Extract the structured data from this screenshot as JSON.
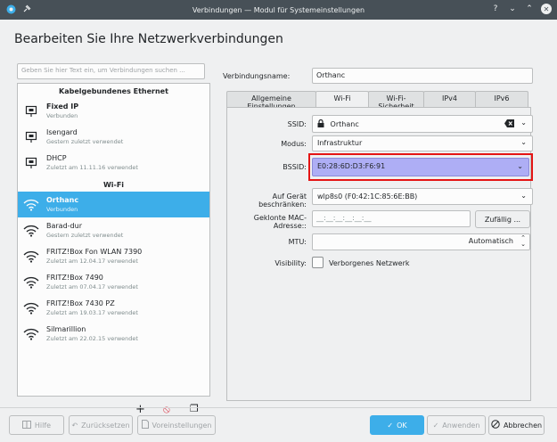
{
  "window": {
    "title": "Verbindungen — Modul für Systemeinstellungen",
    "help_glyph": "?",
    "min_glyph": "⌄",
    "max_glyph": "⌃",
    "close_glyph": "✕"
  },
  "heading": "Bearbeiten Sie Ihre Netzwerkverbindungen",
  "search": {
    "placeholder": "Geben Sie hier Text ein, um Verbindungen suchen ..."
  },
  "sections": {
    "wired": {
      "title": "Kabelgebundenes Ethernet",
      "items": [
        {
          "name": "Fixed IP",
          "sub": "Verbunden",
          "icon": "ethernet-icon",
          "bold": true
        },
        {
          "name": "Isengard",
          "sub": "Gestern zuletzt verwendet",
          "icon": "ethernet-icon"
        },
        {
          "name": "DHCP",
          "sub": "Zuletzt am 11.11.16 verwendet",
          "icon": "ethernet-icon"
        }
      ]
    },
    "wifi": {
      "title": "Wi-Fi",
      "items": [
        {
          "name": "Orthanc",
          "sub": "Verbunden",
          "icon": "wifi-icon",
          "bold": true,
          "selected": true
        },
        {
          "name": "Barad-dur",
          "sub": "Gestern zuletzt verwendet",
          "icon": "wifi-icon"
        },
        {
          "name": "FRITZ!Box Fon WLAN 7390",
          "sub": "Zuletzt am 12.04.17 verwendet",
          "icon": "wifi-icon"
        },
        {
          "name": "FRITZ!Box 7490",
          "sub": "Zuletzt am 07.04.17 verwendet",
          "icon": "wifi-icon"
        },
        {
          "name": "FRITZ!Box 7430 PZ",
          "sub": "Zuletzt am 19.03.17 verwendet",
          "icon": "wifi-icon"
        },
        {
          "name": "Silmarillion",
          "sub": "Zuletzt am 22.02.15 verwendet",
          "icon": "wifi-icon"
        }
      ]
    }
  },
  "list_tools": {
    "add": "+",
    "remove": "⦸",
    "export": "❐"
  },
  "connection": {
    "label": "Verbindungsname:",
    "value": "Orthanc"
  },
  "tabs": [
    "Allgemeine Einstellungen",
    "Wi-Fi",
    "Wi-Fi-Sicherheit",
    "IPv4",
    "IPv6"
  ],
  "active_tab": 1,
  "wifi": {
    "ssid_label": "SSID:",
    "ssid_value": "Orthanc",
    "mode_label": "Modus:",
    "mode_value": "Infrastruktur",
    "bssid_label": "BSSID:",
    "bssid_value": "E0:28:6D:D3:F6:91",
    "device_label": "Auf Gerät beschränken:",
    "device_value": "wlp8s0 (F0:42:1C:85:6E:BB)",
    "mac_label": "Geklonte MAC-Adresse::",
    "mac_value": "__:__:__:__:__:__",
    "random_button": "Zufällig ...",
    "mtu_label": "MTU:",
    "mtu_value": "Automatisch",
    "visibility_label": "Visibility:",
    "hidden_network": "Verborgenes Netzwerk"
  },
  "footer": {
    "help": "Hilfe",
    "reset": "Zurücksetzen",
    "defaults": "Voreinstellungen",
    "ok": "OK",
    "apply": "Anwenden",
    "cancel": "Abbrechen"
  },
  "colors": {
    "titlebar": "#475057",
    "accent": "#3daee9",
    "bssid_bg": "#aeaef5",
    "highlight": "#e41515"
  }
}
